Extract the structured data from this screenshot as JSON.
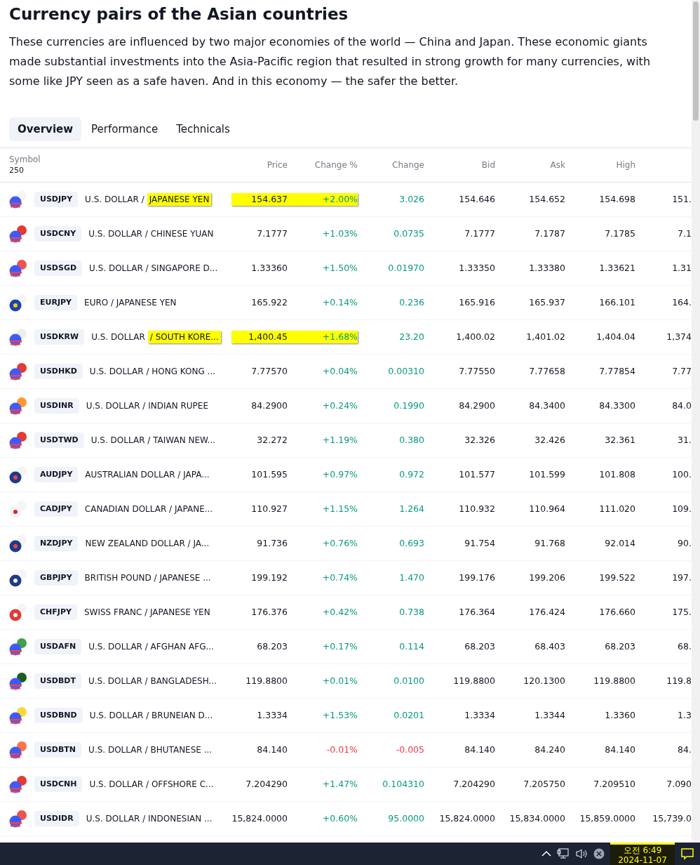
{
  "title": "Currency pairs of the Asian countries",
  "description": "These currencies are influenced by two major economies of the world — China and Japan. These economic giants made substantial investments into the Asia-Pacific region that resulted in strong growth for many currencies, with some like JPY seen as a safe haven. And in this economy — the safer the better.",
  "tabs": [
    {
      "label": "Overview",
      "selected": true
    },
    {
      "label": "Performance",
      "selected": false
    },
    {
      "label": "Technicals",
      "selected": false
    }
  ],
  "table": {
    "symbol_header": "Symbol",
    "symbol_count": "250",
    "columns": [
      "Price",
      "Change %",
      "Change",
      "Bid",
      "Ask",
      "High"
    ],
    "rows": [
      {
        "kind": "usd",
        "color": "#f5f5f5",
        "symbol": "USDJPY",
        "name": "U.S. DOLLAR /",
        "name_highlight": "JAPANESE YEN",
        "highlighted": true,
        "negative": false,
        "price": "154.637",
        "change_pct": "+2.00%",
        "change": "3.026",
        "bid": "154.646",
        "ask": "154.652",
        "high": "154.698",
        "low": "151."
      },
      {
        "kind": "usd",
        "color": "#e53935",
        "symbol": "USDCNY",
        "name": "U.S. DOLLAR / CHINESE YUAN",
        "highlighted": false,
        "negative": false,
        "price": "7.1777",
        "change_pct": "+1.03%",
        "change": "0.0735",
        "bid": "7.1777",
        "ask": "7.1787",
        "high": "7.1785",
        "low": "7.1"
      },
      {
        "kind": "usd",
        "color": "#ef5350",
        "symbol": "USDSGD",
        "name": "U.S. DOLLAR / SINGAPORE D...",
        "highlighted": false,
        "negative": false,
        "price": "1.33360",
        "change_pct": "+1.50%",
        "change": "0.01970",
        "bid": "1.33350",
        "ask": "1.33380",
        "high": "1.33621",
        "low": "1.31"
      },
      {
        "kind": "eur",
        "color": "#f5f5f5",
        "symbol": "EURJPY",
        "name": "EURO / JAPANESE YEN",
        "highlighted": false,
        "negative": false,
        "price": "165.922",
        "change_pct": "+0.14%",
        "change": "0.236",
        "bid": "165.916",
        "ask": "165.937",
        "high": "166.101",
        "low": "164."
      },
      {
        "kind": "usd",
        "color": "#eeeeee",
        "symbol": "USDKRW",
        "name": "U.S. DOLLAR",
        "name_highlight": "/ SOUTH KORE...",
        "highlighted": true,
        "negative": false,
        "price": "1,400.45",
        "change_pct": "+1.68%",
        "change": "23.20",
        "bid": "1,400.02",
        "ask": "1,401.02",
        "high": "1,404.04",
        "low": "1,374"
      },
      {
        "kind": "usd",
        "color": "#e53935",
        "symbol": "USDHKD",
        "name": "U.S. DOLLAR / HONG KONG ...",
        "highlighted": false,
        "negative": false,
        "price": "7.77570",
        "change_pct": "+0.04%",
        "change": "0.00310",
        "bid": "7.77550",
        "ask": "7.77658",
        "high": "7.77854",
        "low": "7.77"
      },
      {
        "kind": "usd",
        "color": "#ff9933",
        "symbol": "USDINR",
        "name": "U.S. DOLLAR / INDIAN RUPEE",
        "highlighted": false,
        "negative": false,
        "price": "84.2900",
        "change_pct": "+0.24%",
        "change": "0.1990",
        "bid": "84.2900",
        "ask": "84.3400",
        "high": "84.3300",
        "low": "84.0"
      },
      {
        "kind": "usd",
        "color": "#e53935",
        "symbol": "USDTWD",
        "name": "U.S. DOLLAR / TAIWAN NEW...",
        "highlighted": false,
        "negative": false,
        "price": "32.272",
        "change_pct": "+1.19%",
        "change": "0.380",
        "bid": "32.326",
        "ask": "32.426",
        "high": "32.361",
        "low": "31."
      },
      {
        "kind": "aud",
        "color": "#f5f5f5",
        "symbol": "AUDJPY",
        "name": "AUSTRALIAN DOLLAR / JAPA...",
        "highlighted": false,
        "negative": false,
        "price": "101.595",
        "change_pct": "+0.97%",
        "change": "0.972",
        "bid": "101.577",
        "ask": "101.599",
        "high": "101.808",
        "low": "100."
      },
      {
        "kind": "cad",
        "color": "#f5f5f5",
        "symbol": "CADJPY",
        "name": "CANADIAN DOLLAR / JAPANE...",
        "highlighted": false,
        "negative": false,
        "price": "110.927",
        "change_pct": "+1.15%",
        "change": "1.264",
        "bid": "110.932",
        "ask": "110.964",
        "high": "111.020",
        "low": "109."
      },
      {
        "kind": "nzd",
        "color": "#f5f5f5",
        "symbol": "NZDJPY",
        "name": "NEW ZEALAND DOLLAR / JA...",
        "highlighted": false,
        "negative": false,
        "price": "91.736",
        "change_pct": "+0.76%",
        "change": "0.693",
        "bid": "91.754",
        "ask": "91.768",
        "high": "92.014",
        "low": "90."
      },
      {
        "kind": "gbp",
        "color": "#f5f5f5",
        "symbol": "GBPJPY",
        "name": "BRITISH POUND / JAPANESE ...",
        "highlighted": false,
        "negative": false,
        "price": "199.192",
        "change_pct": "+0.74%",
        "change": "1.470",
        "bid": "199.176",
        "ask": "199.206",
        "high": "199.522",
        "low": "197."
      },
      {
        "kind": "chf",
        "color": "#f5f5f5",
        "symbol": "CHFJPY",
        "name": "SWISS FRANC / JAPANESE YEN",
        "highlighted": false,
        "negative": false,
        "price": "176.376",
        "change_pct": "+0.42%",
        "change": "0.738",
        "bid": "176.364",
        "ask": "176.424",
        "high": "176.660",
        "low": "175."
      },
      {
        "kind": "usd",
        "color": "#43a047",
        "symbol": "USDAFN",
        "name": "U.S. DOLLAR / AFGHAN AFG...",
        "highlighted": false,
        "negative": false,
        "price": "68.203",
        "change_pct": "+0.17%",
        "change": "0.114",
        "bid": "68.203",
        "ask": "68.403",
        "high": "68.203",
        "low": "68."
      },
      {
        "kind": "usd",
        "color": "#1b5e20",
        "symbol": "USDBDT",
        "name": "U.S. DOLLAR / BANGLADESH...",
        "highlighted": false,
        "negative": false,
        "price": "119.8800",
        "change_pct": "+0.01%",
        "change": "0.0100",
        "bid": "119.8800",
        "ask": "120.1300",
        "high": "119.8800",
        "low": "119.8"
      },
      {
        "kind": "usd",
        "color": "#fdd835",
        "symbol": "USDBND",
        "name": "U.S. DOLLAR / BRUNEIAN D...",
        "highlighted": false,
        "negative": false,
        "price": "1.3334",
        "change_pct": "+1.53%",
        "change": "0.0201",
        "bid": "1.3334",
        "ask": "1.3344",
        "high": "1.3360",
        "low": "1.3"
      },
      {
        "kind": "usd",
        "color": "#ff7043",
        "symbol": "USDBTN",
        "name": "U.S. DOLLAR / BHUTANESE ...",
        "highlighted": false,
        "negative": true,
        "price": "84.140",
        "change_pct": "-0.01%",
        "change": "-0.005",
        "bid": "84.140",
        "ask": "84.240",
        "high": "84.140",
        "low": "84."
      },
      {
        "kind": "usd",
        "color": "#e53935",
        "symbol": "USDCNH",
        "name": "U.S. DOLLAR / OFFSHORE C...",
        "highlighted": false,
        "negative": false,
        "price": "7.204290",
        "change_pct": "+1.47%",
        "change": "0.104310",
        "bid": "7.204290",
        "ask": "7.205750",
        "high": "7.209510",
        "low": "7.090"
      },
      {
        "kind": "usd",
        "color": "#ef5350",
        "symbol": "USDIDR",
        "name": "U.S. DOLLAR / INDONESIAN ...",
        "highlighted": false,
        "negative": false,
        "price": "15,824.0000",
        "change_pct": "+0.60%",
        "change": "95.0000",
        "bid": "15,824.0000",
        "ask": "15,834.0000",
        "high": "15,859.0000",
        "low": "15,739.0"
      }
    ]
  },
  "taskbar": {
    "time": "오전 6:49",
    "date": "2024-11-07"
  }
}
